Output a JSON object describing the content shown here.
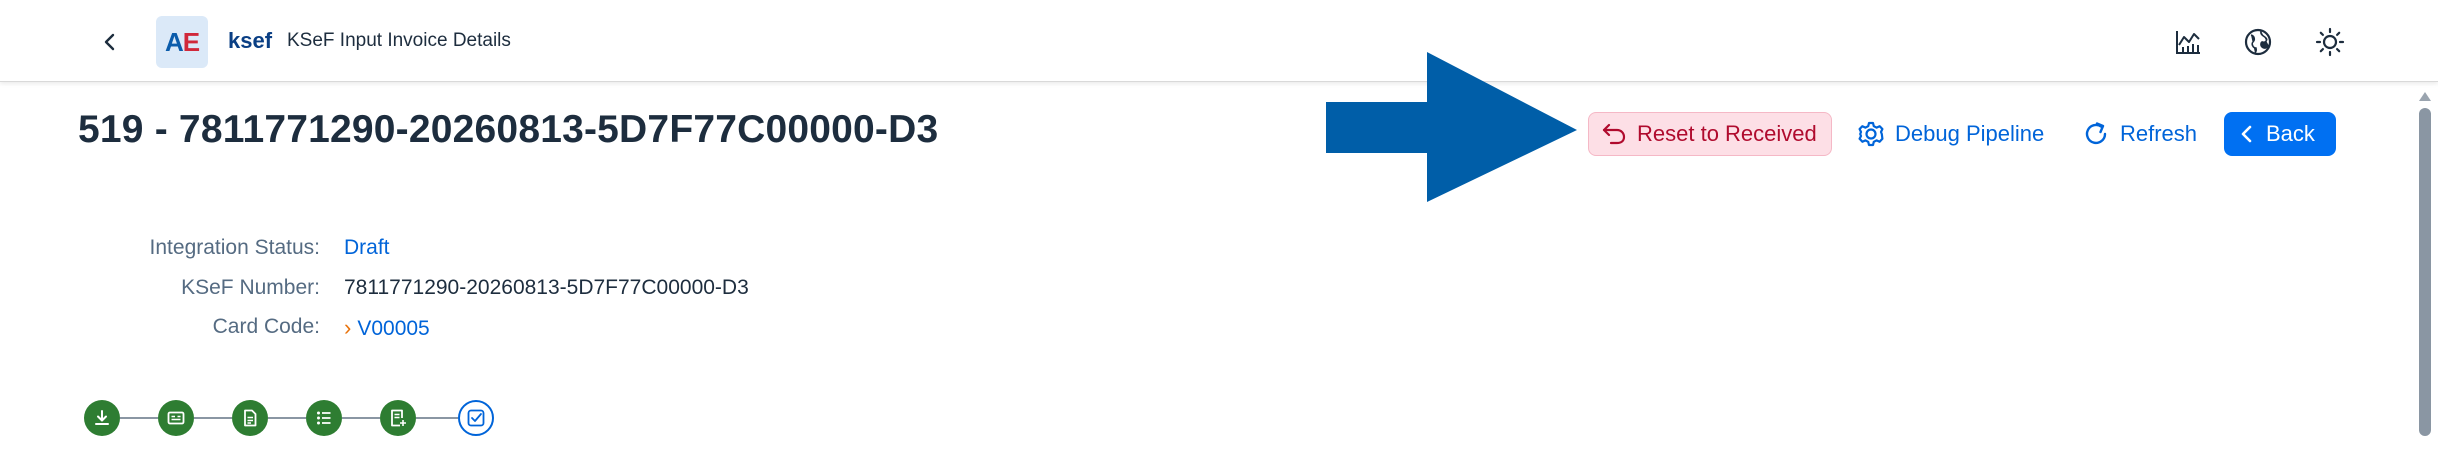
{
  "shell": {
    "logo_letters": [
      "A",
      "E"
    ],
    "app_name": "ksef",
    "title": "KSeF Input Invoice Details",
    "icons": [
      "chart-icon",
      "globe-icon",
      "sun-icon"
    ]
  },
  "page": {
    "title": "519 - 7811771290-20260813-5D7F77C00000-D3"
  },
  "actions": {
    "reset_label": "Reset to Received",
    "debug_label": "Debug Pipeline",
    "refresh_label": "Refresh",
    "back_label": "Back"
  },
  "form": {
    "fields": [
      {
        "label": "Integration Status:",
        "value": "Draft"
      },
      {
        "label": "KSeF Number:",
        "value": "7811771290-20260813-5D7F77C00000-D3"
      },
      {
        "label": "Card Code:",
        "value": "V00005"
      }
    ]
  },
  "process_flow": {
    "steps": [
      {
        "icon": "download-icon",
        "status": "done"
      },
      {
        "icon": "id-card-icon",
        "status": "done"
      },
      {
        "icon": "document-icon",
        "status": "done"
      },
      {
        "icon": "list-icon",
        "status": "done"
      },
      {
        "icon": "document-add-icon",
        "status": "done"
      },
      {
        "icon": "checkbox-icon",
        "status": "current"
      }
    ]
  },
  "colors": {
    "accent": "#0064d9",
    "emphasized_button": "#0070f2",
    "reset_bg": "#fddfe6",
    "reset_text": "#b00b2e",
    "step_done": "#2e7d32",
    "annotation_arrow": "#005ea8"
  }
}
